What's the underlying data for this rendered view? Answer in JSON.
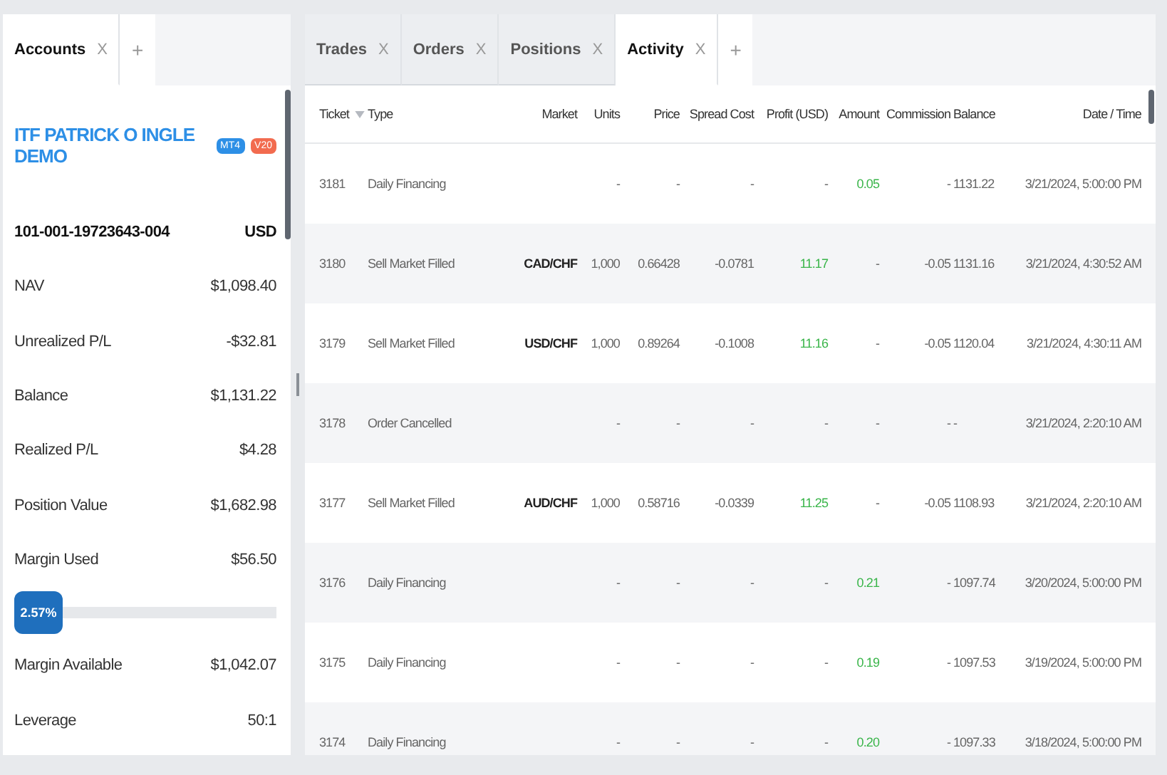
{
  "accounts_panel": {
    "tabs": [
      {
        "label": "Accounts",
        "close": "X",
        "selected": true
      }
    ],
    "add_tab": "+",
    "account": {
      "name": "ITF PATRICK O INGLE DEMO",
      "badges": [
        {
          "label": "MT4",
          "color": "#2d8fe6"
        },
        {
          "label": "V20",
          "color": "#f26b4f"
        }
      ],
      "id": "101-001-19723643-004",
      "currency": "USD"
    },
    "metrics": [
      {
        "label": "NAV",
        "value": "$1,098.40"
      },
      {
        "label": "Unrealized P/L",
        "value": "-$32.81"
      },
      {
        "label": "Balance",
        "value": "$1,131.22"
      },
      {
        "label": "Realized P/L",
        "value": "$4.28"
      },
      {
        "label": "Position Value",
        "value": "$1,682.98"
      },
      {
        "label": "Margin Used",
        "value": "$56.50"
      }
    ],
    "margin_bar": {
      "level": 0.0257,
      "reading": "2.57%"
    },
    "metrics_after": [
      {
        "label": "Margin Available",
        "value": "$1,042.07"
      },
      {
        "label": "Leverage",
        "value": "50:1"
      }
    ]
  },
  "activity_panel": {
    "tabs": [
      {
        "label": "Trades",
        "close": "X",
        "selected": false
      },
      {
        "label": "Orders",
        "close": "X",
        "selected": false
      },
      {
        "label": "Positions",
        "close": "X",
        "selected": false
      },
      {
        "label": "Activity",
        "close": "X",
        "selected": true
      }
    ],
    "add_tab": "+",
    "table": {
      "columns": [
        {
          "label": "Ticket",
          "sorted": true
        },
        {
          "label": "Type",
          "sorted": false
        },
        {
          "label": "Market",
          "sorted": false
        },
        {
          "label": "Units",
          "sorted": false
        },
        {
          "label": "Price",
          "sorted": false
        },
        {
          "label": "Spread Cost",
          "sorted": false
        },
        {
          "label": "Profit (USD)",
          "sorted": false
        },
        {
          "label": "Amount",
          "sorted": false
        },
        {
          "label": "Commission",
          "sorted": false
        },
        {
          "label": "Balance",
          "sorted": false
        },
        {
          "label": "Date / Time",
          "sorted": false
        }
      ],
      "rows": [
        {
          "cells": [
            "3181",
            "Daily Financing",
            "",
            "-",
            "-",
            "-",
            "-",
            "0.05",
            "-",
            "1131.22",
            "3/21/2024, 5:00:00 PM"
          ],
          "profit_positive": false,
          "amount_positive": true
        },
        {
          "cells": [
            "3180",
            "Sell Market Filled",
            "CAD/CHF",
            "1,000",
            "0.66428",
            "-0.0781",
            "11.17",
            "-",
            "-0.05",
            "1131.16",
            "3/21/2024, 4:30:52 AM"
          ],
          "profit_positive": true,
          "amount_positive": false
        },
        {
          "cells": [
            "3179",
            "Sell Market Filled",
            "USD/CHF",
            "1,000",
            "0.89264",
            "-0.1008",
            "11.16",
            "-",
            "-0.05",
            "1120.04",
            "3/21/2024, 4:30:11 AM"
          ],
          "profit_positive": true,
          "amount_positive": false
        },
        {
          "cells": [
            "3178",
            "Order Cancelled",
            "",
            "-",
            "-",
            "-",
            "-",
            "-",
            "-",
            "-",
            "3/21/2024, 2:20:10 AM"
          ],
          "profit_positive": false,
          "amount_positive": false
        },
        {
          "cells": [
            "3177",
            "Sell Market Filled",
            "AUD/CHF",
            "1,000",
            "0.58716",
            "-0.0339",
            "11.25",
            "-",
            "-0.05",
            "1108.93",
            "3/21/2024, 2:20:10 AM"
          ],
          "profit_positive": true,
          "amount_positive": false
        },
        {
          "cells": [
            "3176",
            "Daily Financing",
            "",
            "-",
            "-",
            "-",
            "-",
            "0.21",
            "-",
            "1097.74",
            "3/20/2024, 5:00:00 PM"
          ],
          "profit_positive": false,
          "amount_positive": true
        },
        {
          "cells": [
            "3175",
            "Daily Financing",
            "",
            "-",
            "-",
            "-",
            "-",
            "0.19",
            "-",
            "1097.53",
            "3/19/2024, 5:00:00 PM"
          ],
          "profit_positive": false,
          "amount_positive": true
        },
        {
          "cells": [
            "3174",
            "Daily Financing",
            "",
            "-",
            "-",
            "-",
            "-",
            "0.20",
            "-",
            "1097.33",
            "3/18/2024, 5:00:00 PM"
          ],
          "profit_positive": false,
          "amount_positive": true
        }
      ]
    }
  }
}
